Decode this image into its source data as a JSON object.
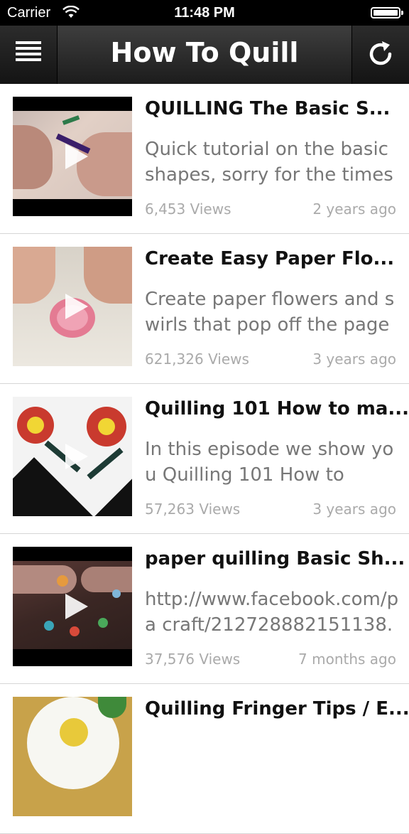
{
  "status_bar": {
    "carrier": "Carrier",
    "time": "11:48 PM"
  },
  "nav": {
    "title": "How To Quill",
    "menu_icon": "hamburger-menu-icon",
    "refresh_icon": "refresh-icon"
  },
  "videos": [
    {
      "title": "QUILLING The Basic S...",
      "description": "Quick tutorial on the basic shapes, sorry for the times",
      "views": "6,453 Views",
      "age": "2 years ago"
    },
    {
      "title": "Create Easy Paper Flo...",
      "description": "Create paper flowers and swirls that pop off the page",
      "views": "621,326 Views",
      "age": "3 years ago"
    },
    {
      "title": "Quilling 101 How to ma...",
      "description": "In this episode we show you Quilling 101 How to",
      "views": "57,263 Views",
      "age": "3 years ago"
    },
    {
      "title": "paper quilling Basic Sh...",
      "description": "http://www.facebook.com/pa craft/212728882151138.",
      "views": "37,576 Views",
      "age": "7 months ago"
    },
    {
      "title": "Quilling Fringer Tips / E...",
      "description": "",
      "views": "",
      "age": ""
    }
  ],
  "colors": {
    "nav_background": "#2a2a2a",
    "title_text": "#111111",
    "description_text": "#777777",
    "meta_text": "#aaaaaa"
  }
}
